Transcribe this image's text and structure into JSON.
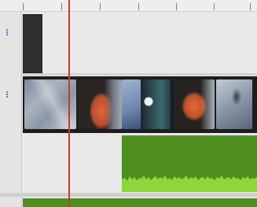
{
  "timeline": {
    "ruler_ticks": 7,
    "tracks": [
      {
        "kind": "video-overlay",
        "clip": "dark"
      },
      {
        "kind": "video",
        "clip": "filmstrip"
      },
      {
        "kind": "audio",
        "clip": "waveform"
      }
    ],
    "colors": {
      "playhead": "#e0301e",
      "audio_clip": "#4f8f1f",
      "track_handle": "#3c86d6",
      "dark_clip": "#2f2f2f",
      "filmstrip_bg": "#1d1d1d"
    },
    "filmstrip_frames": [
      {
        "name": "frame-grey-rock",
        "tone": "grey-blue"
      },
      {
        "name": "frame-orange-board",
        "tone": "orange-dark"
      },
      {
        "name": "frame-blue-figure",
        "tone": "blue"
      },
      {
        "name": "frame-teal-rock",
        "tone": "teal"
      },
      {
        "name": "frame-orange-board-2",
        "tone": "orange-dark"
      },
      {
        "name": "frame-climber",
        "tone": "grey-blue"
      }
    ]
  }
}
